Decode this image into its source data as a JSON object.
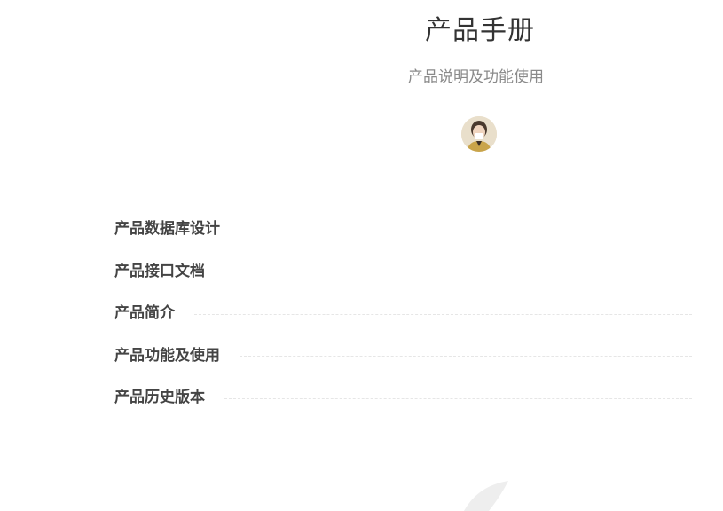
{
  "header": {
    "title": "产品手册",
    "subtitle": "产品说明及功能使用",
    "avatar_icon": "avatar-photo"
  },
  "toc": {
    "items": [
      {
        "label": "产品数据库设计",
        "leader": false
      },
      {
        "label": "产品接口文档",
        "leader": false
      },
      {
        "label": "产品简介",
        "leader": true
      },
      {
        "label": "产品功能及使用",
        "leader": true
      },
      {
        "label": "产品历史版本",
        "leader": true
      }
    ]
  },
  "colors": {
    "title": "#333333",
    "subtitle": "#8a8a8a",
    "toc_text": "#444444",
    "leader": "#e6e6e6",
    "decoration": "#eeeeee"
  }
}
